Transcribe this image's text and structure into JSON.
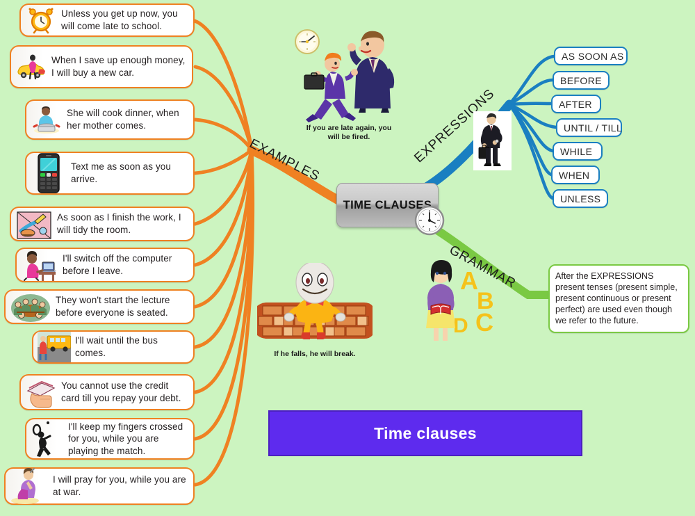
{
  "page": {
    "background_color": "#ccf4c0",
    "center_node_label": "TIME CLAUSES",
    "title_bar_label": "Time clauses",
    "accent_colors": {
      "examples_branch": "#ef8122",
      "expressions_branch": "#1a7fc1",
      "grammar_branch": "#7ac943",
      "title_bar": "#5e2bee"
    }
  },
  "branches": {
    "examples_label": "EXAMPLES",
    "expressions_label": "EXPRESSIONS",
    "grammar_label": "GRAMMAR"
  },
  "examples": [
    {
      "text": "Unless you get up now, you will come late to school.",
      "icon": "alarm-clock-icon"
    },
    {
      "text": "When I save up enough money, I will buy a new car.",
      "icon": "new-car-icon"
    },
    {
      "text": "She will cook dinner, when her mother comes.",
      "icon": "cooking-icon"
    },
    {
      "text": "Text me as soon as you arrive.",
      "icon": "mobile-phone-icon"
    },
    {
      "text": "As soon as I finish the work, I will tidy the room.",
      "icon": "cleaning-tools-icon"
    },
    {
      "text": "I'll switch off the computer before I leave.",
      "icon": "person-at-computer-icon"
    },
    {
      "text": "They won't start the lecture before everyone is seated.",
      "icon": "lecture-audience-icon"
    },
    {
      "text": "I'll wait until the bus comes.",
      "icon": "school-bus-icon"
    },
    {
      "text": "You cannot use the credit card till you repay your debt.",
      "icon": "credit-card-hand-icon"
    },
    {
      "text": "I'll keep my fingers crossed for you, while you are playing the match.",
      "icon": "tennis-player-icon"
    },
    {
      "text": "I will pray for you, while you are at war.",
      "icon": "praying-person-icon"
    }
  ],
  "expressions": [
    {
      "text": "AS SOON AS"
    },
    {
      "text": "BEFORE"
    },
    {
      "text": "AFTER"
    },
    {
      "text": "UNTIL / TILL"
    },
    {
      "text": "WHILE"
    },
    {
      "text": "WHEN"
    },
    {
      "text": "UNLESS"
    }
  ],
  "grammar": {
    "note": "After the EXPRESSIONS present tenses (present simple, present continuous or present perfect) are used even though we refer to the future."
  },
  "illustrations": [
    {
      "name": "late-employee-boss-illustration",
      "caption": "If you are late again, you will be fired."
    },
    {
      "name": "humpty-dumpty-on-wall-illustration",
      "caption": "If he falls, he will break."
    },
    {
      "name": "teacher-with-abc-illustration",
      "caption": ""
    },
    {
      "name": "businessman-checking-watch-illustration",
      "caption": ""
    }
  ]
}
